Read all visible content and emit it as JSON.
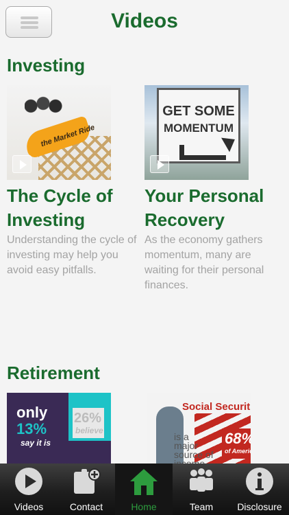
{
  "header": {
    "title": "Videos"
  },
  "sections": [
    {
      "title": "Investing",
      "cards": [
        {
          "title": "The Cycle of Investing",
          "description": "Understanding the cycle of investing may help you avoid easy pitfalls.",
          "thumb_text": "the Market Ride"
        },
        {
          "title": "Your Personal Recovery",
          "description": "As the economy gathers momentum, many are waiting for their personal finances.",
          "thumb_lines": [
            "GET SOME",
            "MOMENTUM"
          ]
        }
      ]
    },
    {
      "title": "Retirement",
      "cards": [
        {
          "thumb_lines": [
            "only",
            "13%",
            "say it is",
            "26%",
            "believe"
          ]
        },
        {
          "thumb_lines": [
            "Social Securit",
            "is a major source of income for",
            "68%",
            "of Americ"
          ]
        }
      ]
    }
  ],
  "tabbar": {
    "active": "Home",
    "tabs": [
      {
        "label": "Videos",
        "icon": "play-circle-icon"
      },
      {
        "label": "Contact",
        "icon": "contact-card-icon"
      },
      {
        "label": "Home",
        "icon": "home-icon"
      },
      {
        "label": "Team",
        "icon": "team-icon"
      },
      {
        "label": "Disclosure",
        "icon": "info-icon"
      }
    ]
  },
  "colors": {
    "accent": "#1a6b2e",
    "active_tab": "#2d9c3e",
    "muted_text": "#a3a3a3"
  }
}
